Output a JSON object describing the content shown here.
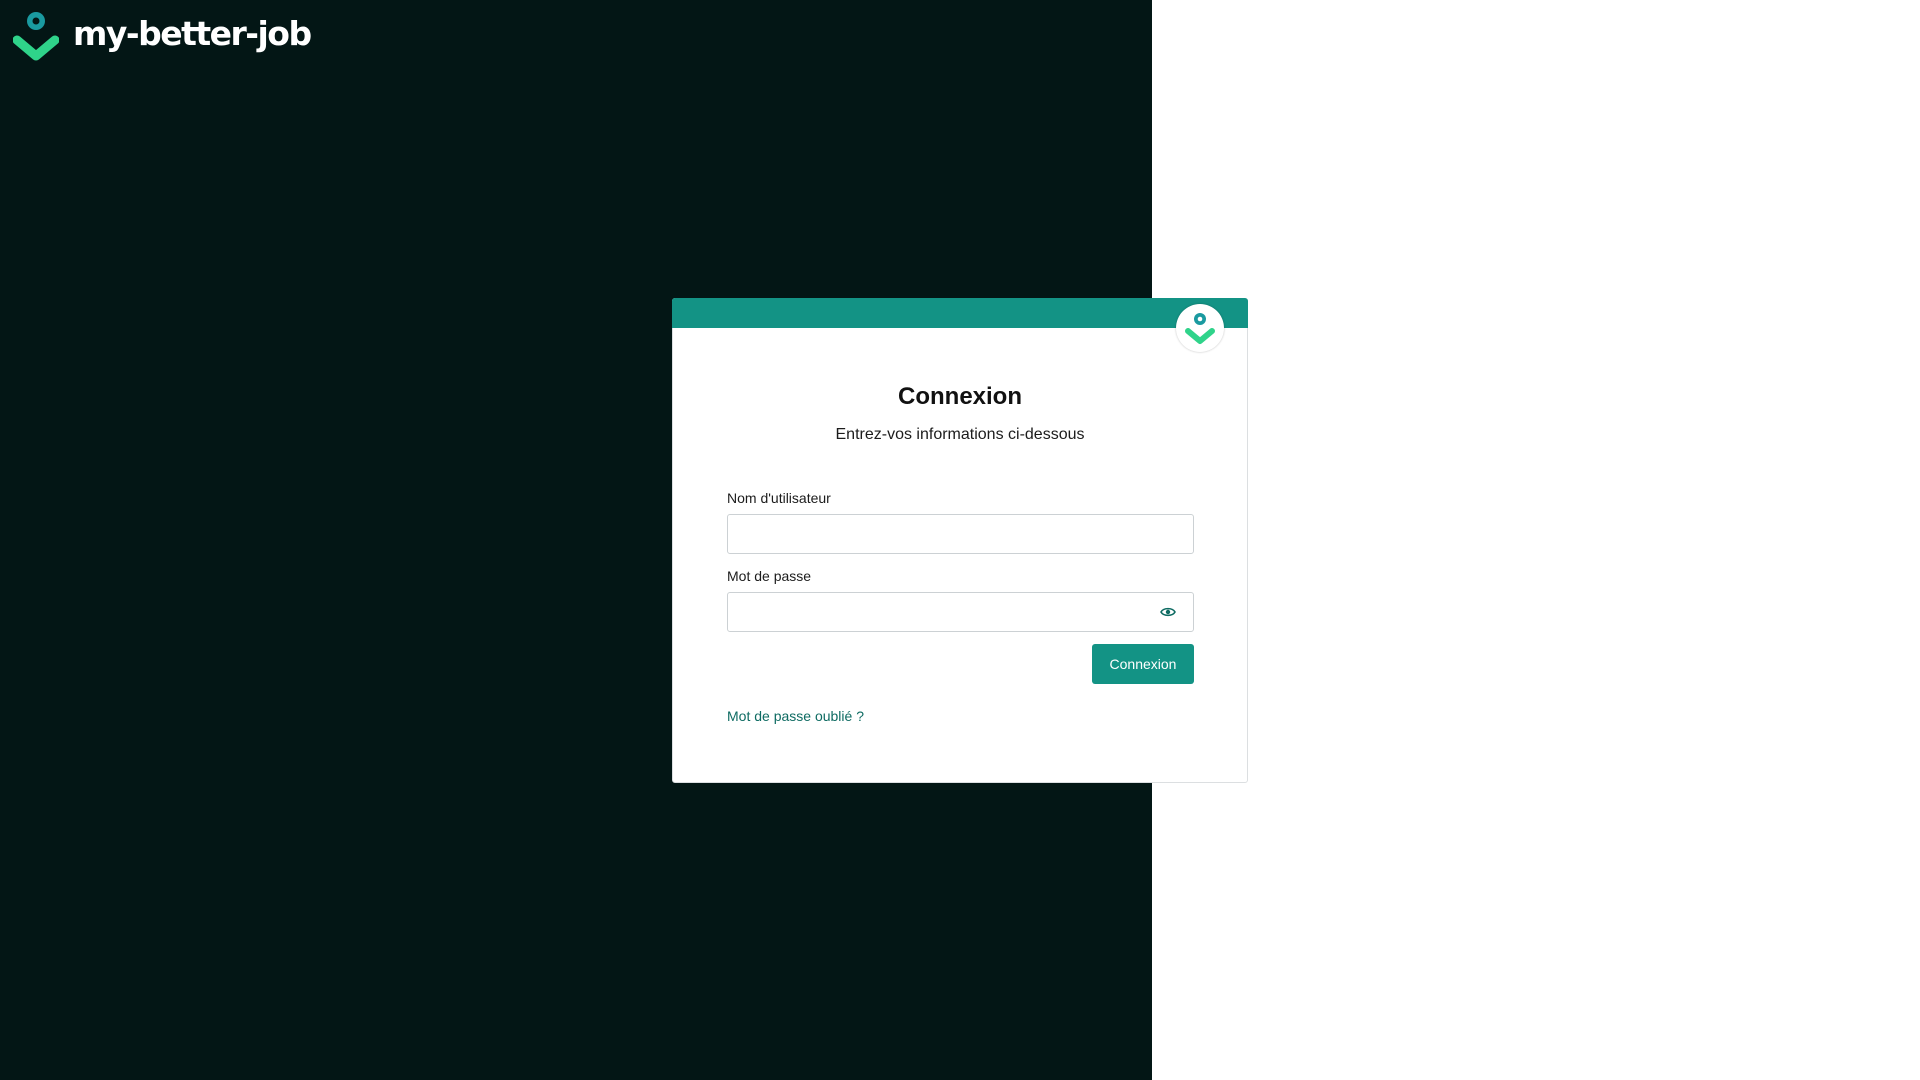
{
  "brand": {
    "name": "my-better-job",
    "logo_icon": "pin-check-logo-icon"
  },
  "colors": {
    "left_panel_bg": "#031615",
    "accent": "#139385",
    "logo_teal": "#1a9aa0",
    "logo_green": "#2fd38a",
    "link": "#0e6b62"
  },
  "login_card": {
    "title": "Connexion",
    "subtitle": "Entrez-vos informations ci-dessous",
    "username": {
      "label": "Nom d'utilisateur",
      "value": "",
      "placeholder": ""
    },
    "password": {
      "label": "Mot de passe",
      "value": "",
      "placeholder": "",
      "toggle_icon": "eye-icon"
    },
    "submit_label": "Connexion",
    "forgot_password_label": "Mot de passe oublié ?"
  }
}
